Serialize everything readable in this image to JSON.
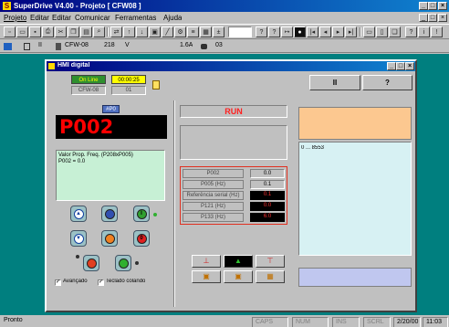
{
  "app": {
    "title": "SuperDrive V4.00 - Projeto [ CFW08 ]",
    "menu": [
      "Projeto",
      "Editar",
      "Editar",
      "Comunicar",
      "Ferramentas",
      "Ajuda"
    ],
    "toolbar2": {
      "inverter": "CFW-08",
      "voltage": "218",
      "voltage_unit": "V",
      "current": "1.6A",
      "item": "03"
    }
  },
  "hmi": {
    "title": "HMI digital",
    "online_label": "On Line",
    "time": "00:00:25",
    "model": "CFW-08",
    "address": "01",
    "unit_label": "#P0",
    "display": "P002",
    "info_text": "Valor Prop. Freq. (P208xP005)\nP002 = 0.0",
    "avancado_label": "Avançado",
    "teclado_label": "Teclado colando",
    "run_label": "RUN",
    "scale_label": "0 ... 8553",
    "params": [
      {
        "name": "P002",
        "value": "0.0"
      },
      {
        "name": "P005 (Hz)",
        "value": "0.1"
      },
      {
        "name": "Referência serial (Hz)",
        "value": "0.1"
      },
      {
        "name": "P121 (Hz)",
        "value": "0.0"
      },
      {
        "name": "P133 (Hz)",
        "value": "6.0"
      }
    ],
    "top_buttons": [
      "II",
      "?"
    ]
  },
  "statusbar": {
    "ready": "Pronto",
    "caps": "CAPS",
    "num": "NUM",
    "ins": "INS",
    "scrl": "SCRL",
    "date": "2/20/00",
    "time": "11:03 AM"
  },
  "colors": {
    "desktop": "#007f7f",
    "title_active": "#000080",
    "display_red": "#ff0000",
    "online_green": "#2f8f2f",
    "time_yellow": "#ffff00",
    "orange_panel": "#fcc890",
    "params_border": "#e03020"
  }
}
